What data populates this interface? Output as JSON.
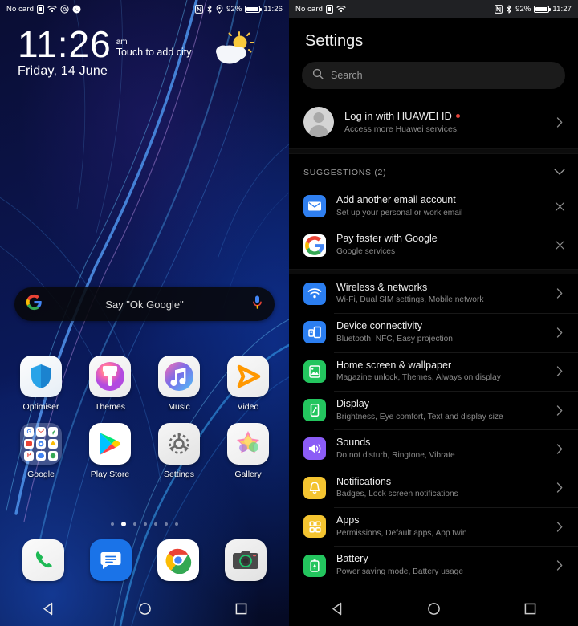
{
  "home": {
    "status_bar": {
      "carrier": "No card",
      "icons_left": [
        "sim-card-icon",
        "wifi-icon",
        "email-at-icon",
        "phone-call-icon"
      ],
      "icons_right": [
        "nfc-icon",
        "bluetooth-icon",
        "location-icon"
      ],
      "battery_percent": "92%",
      "time": "11:26"
    },
    "clock": {
      "time": "11:26",
      "ampm": "am",
      "city_hint": "Touch to add city",
      "date": "Friday, 14 June",
      "weather_icon": "partly-cloudy-icon"
    },
    "google_bar": {
      "logo": "google-g-icon",
      "hint": "Say \"Ok Google\"",
      "mic": "microphone-icon"
    },
    "apps_row1": [
      {
        "label": "Optimiser",
        "icon": "optimiser-shield-icon"
      },
      {
        "label": "Themes",
        "icon": "themes-brush-icon"
      },
      {
        "label": "Music",
        "icon": "music-note-icon"
      },
      {
        "label": "Video",
        "icon": "video-play-icon"
      }
    ],
    "apps_row2": [
      {
        "label": "Google",
        "icon": "google-folder-icon"
      },
      {
        "label": "Play Store",
        "icon": "play-store-icon"
      },
      {
        "label": "Settings",
        "icon": "settings-gear-icon"
      },
      {
        "label": "Gallery",
        "icon": "gallery-flower-icon"
      }
    ],
    "page_dots": {
      "count": 7,
      "active_index": 1
    },
    "dock": [
      {
        "label": "Phone",
        "icon": "phone-handset-icon"
      },
      {
        "label": "Messages",
        "icon": "messages-bubble-icon"
      },
      {
        "label": "Chrome",
        "icon": "chrome-icon"
      },
      {
        "label": "Camera",
        "icon": "camera-icon"
      }
    ],
    "nav_bar": [
      {
        "label": "Back",
        "icon": "back-triangle-icon"
      },
      {
        "label": "Home",
        "icon": "home-circle-icon"
      },
      {
        "label": "Recents",
        "icon": "recents-square-icon"
      }
    ]
  },
  "settings": {
    "status_bar": {
      "carrier": "No card",
      "icons_left": [
        "sim-card-icon",
        "wifi-icon"
      ],
      "icons_right": [
        "nfc-icon",
        "bluetooth-icon"
      ],
      "battery_percent": "92%",
      "time": "11:27"
    },
    "title": "Settings",
    "search": {
      "placeholder": "Search",
      "icon": "search-icon"
    },
    "account": {
      "title": "Log in with HUAWEI ID",
      "subtitle": "Access more Huawei services.",
      "chevron": "chevron-right-icon",
      "badge_color": "#e8453c"
    },
    "suggestions": {
      "header": "SUGGESTIONS (2)",
      "collapse_icon": "chevron-down-icon",
      "items": [
        {
          "title": "Add another email account",
          "subtitle": "Set up your personal or work email",
          "icon": "email-envelope-icon",
          "icon_color": "#2f7ff0",
          "dismiss": "close-icon"
        },
        {
          "title": "Pay faster with Google",
          "subtitle": "Google services",
          "icon": "google-g-icon",
          "icon_color": "#ea4335",
          "dismiss": "close-icon"
        }
      ]
    },
    "main_items": [
      {
        "title": "Wireless & networks",
        "subtitle": "Wi-Fi, Dual SIM settings, Mobile network",
        "icon": "wifi-icon",
        "icon_color": "#2b7ef0",
        "chevron": "chevron-right-icon"
      },
      {
        "title": "Device connectivity",
        "subtitle": "Bluetooth, NFC, Easy projection",
        "icon": "device-connectivity-icon",
        "icon_color": "#2b7ef0",
        "chevron": "chevron-right-icon"
      },
      {
        "title": "Home screen & wallpaper",
        "subtitle": "Magazine unlock, Themes, Always on display",
        "icon": "wallpaper-image-icon",
        "icon_color": "#23c55e",
        "chevron": "chevron-right-icon"
      },
      {
        "title": "Display",
        "subtitle": "Brightness, Eye comfort, Text and display size",
        "icon": "display-phone-icon",
        "icon_color": "#23c55e",
        "chevron": "chevron-right-icon"
      },
      {
        "title": "Sounds",
        "subtitle": "Do not disturb, Ringtone, Vibrate",
        "icon": "speaker-volume-icon",
        "icon_color": "#8b5cf6",
        "chevron": "chevron-right-icon"
      },
      {
        "title": "Notifications",
        "subtitle": "Badges, Lock screen notifications",
        "icon": "bell-icon",
        "icon_color": "#f4c430",
        "chevron": "chevron-right-icon"
      },
      {
        "title": "Apps",
        "subtitle": "Permissions, Default apps, App twin",
        "icon": "apps-grid-icon",
        "icon_color": "#f4c430",
        "chevron": "chevron-right-icon"
      },
      {
        "title": "Battery",
        "subtitle": "Power saving mode, Battery usage",
        "icon": "battery-icon",
        "icon_color": "#23c55e",
        "chevron": "chevron-right-icon"
      }
    ],
    "nav_bar": [
      {
        "label": "Back",
        "icon": "back-triangle-icon"
      },
      {
        "label": "Home",
        "icon": "home-circle-icon"
      },
      {
        "label": "Recents",
        "icon": "recents-square-icon"
      }
    ]
  }
}
